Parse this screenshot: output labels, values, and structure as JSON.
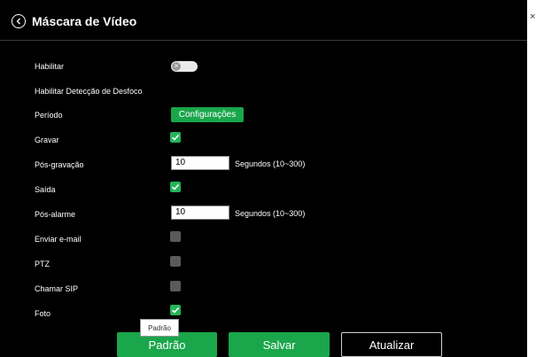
{
  "header": {
    "title": "Máscara de Vídeo"
  },
  "fields": {
    "habilitar": "Habilitar",
    "desfoco": "Habilitar Detecção de Desfoco",
    "periodo": "Período",
    "config_button": "Configurações",
    "gravar": "Gravar",
    "pos_gravacao": "Pós-gravação",
    "pos_gravacao_value": "10",
    "pos_gravacao_unit": "Segundos (10~300)",
    "saida": "Saída",
    "pos_alarme": "Pós-alarme",
    "pos_alarme_value": "10",
    "pos_alarme_unit": "Segundos (10~300)",
    "email": "Enviar e-mail",
    "ptz": "PTZ",
    "sip": "Chamar SIP",
    "foto": "Foto"
  },
  "state": {
    "habilitar": false,
    "gravar": true,
    "saida": true,
    "email": false,
    "ptz": false,
    "sip": false,
    "foto": true
  },
  "buttons": {
    "padrao": "Padrão",
    "salvar": "Salvar",
    "atualizar": "Atualizar"
  },
  "tooltip": "Padrão",
  "colors": {
    "accent": "#1aa64b",
    "background": "#000000"
  }
}
